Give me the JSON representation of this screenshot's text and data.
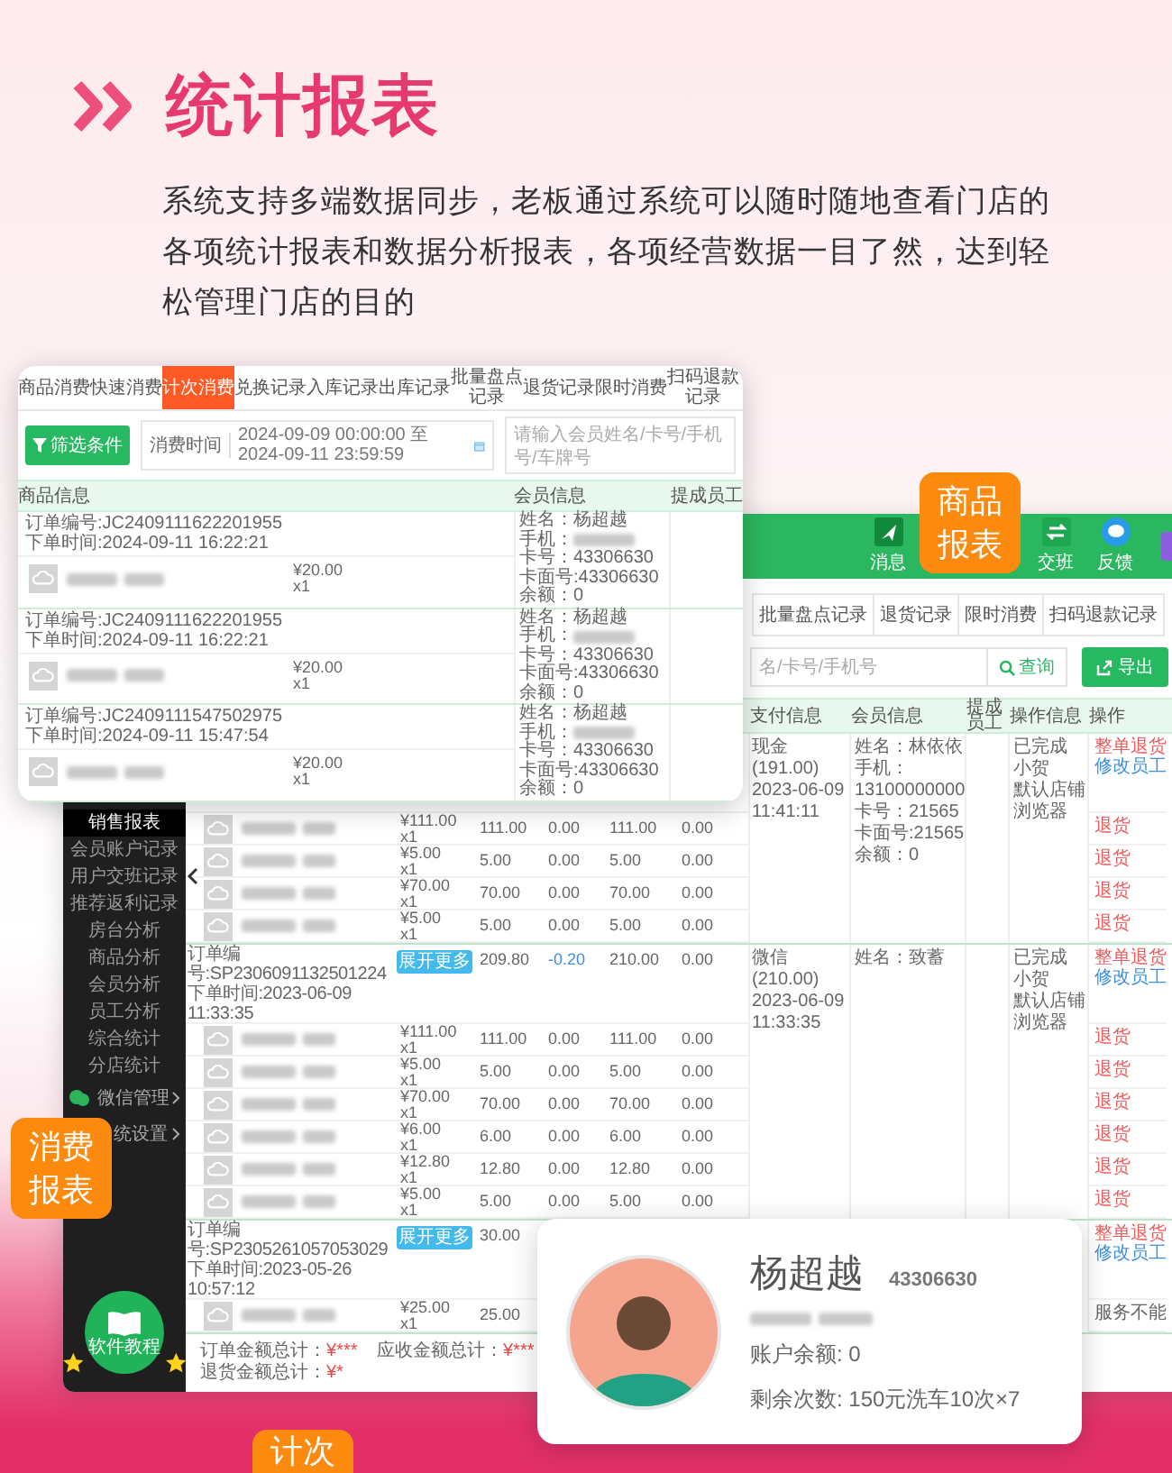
{
  "header": {
    "title": "统计报表",
    "description": "系统支持多端数据同步，老板通过系统可以随时随地查看门店的各项统计报表和数据分析报表，各项经营数据一目了然，达到轻松管理门店的目的"
  },
  "badges": [
    {
      "text": "商品报表",
      "kind": "product"
    },
    {
      "text": "消费报表",
      "kind": "consume"
    },
    {
      "text": "计次",
      "kind": "count"
    }
  ],
  "back_window": {
    "toolbar": [
      {
        "label": "消息",
        "kind": "send"
      },
      {
        "label": "交班",
        "kind": "swap"
      },
      {
        "label": "反馈",
        "kind": "chat"
      },
      {
        "kind": "download"
      }
    ],
    "tabs": [
      "批量盘点记录",
      "退货记录",
      "限时消费",
      "扫码退款记录"
    ],
    "search": {
      "placeholder": "名/卡号/手机号"
    },
    "query_button": "查询",
    "export_button": "导出",
    "columns": [
      "支付信息",
      "会员信息",
      "提成员工",
      "操作信息",
      "操作"
    ],
    "sidebar": {
      "items": [
        {
          "label": "销售报表",
          "selected": true
        },
        {
          "label": "会员账户记录",
          "selected": false
        },
        {
          "label": "用户交班记录",
          "selected": false
        },
        {
          "label": "推荐返利记录",
          "selected": false
        },
        {
          "label": "房台分析",
          "selected": false
        },
        {
          "label": "商品分析",
          "selected": false
        },
        {
          "label": "会员分析",
          "selected": false
        },
        {
          "label": "员工分析",
          "selected": false
        },
        {
          "label": "综合统计",
          "selected": false
        },
        {
          "label": "分店统计",
          "selected": false
        }
      ],
      "groups": [
        {
          "label": "微信管理",
          "kind": "wechat"
        },
        {
          "label": "统设置",
          "kind": "plain"
        }
      ],
      "tutorial": "软件教程"
    },
    "groups": [
      {
        "payment": [
          "现金(191.00)",
          "2023-06-09",
          "11:41:11"
        ],
        "member": [
          "姓名：林依依",
          "手机：13100000000",
          "卡号：21565",
          "卡面号:21565",
          "余额：0"
        ],
        "op_info": [
          "已完成",
          "小贺",
          "默认店铺",
          "浏览器"
        ],
        "actions": [
          "整单退货",
          "修改员工"
        ],
        "items": [
          {
            "price": "¥111.00",
            "qty": "x1",
            "values": [
              "111.00",
              "0.00",
              "111.00",
              "0.00"
            ],
            "action": {
              "text": "退货",
              "kind": "return"
            }
          },
          {
            "price": "¥5.00",
            "qty": "x1",
            "values": [
              "5.00",
              "0.00",
              "5.00",
              "0.00"
            ],
            "action": {
              "text": "退货",
              "kind": "return"
            }
          },
          {
            "price": "¥70.00",
            "qty": "x1",
            "values": [
              "70.00",
              "0.00",
              "70.00",
              "0.00"
            ],
            "action": {
              "text": "退货",
              "kind": "return"
            }
          },
          {
            "price": "¥5.00",
            "qty": "x1",
            "values": [
              "5.00",
              "0.00",
              "5.00",
              "0.00"
            ],
            "action": {
              "text": "退货",
              "kind": "return"
            }
          }
        ]
      },
      {
        "order": {
          "number": "订单编号:SP2306091132501224",
          "time": "下单时间:2023-06-09 11:33:35",
          "badge": "展开更多",
          "values": [
            "209.80",
            "-0.20",
            "210.00",
            "0.00"
          ]
        },
        "payment": [
          "微信(210.00)",
          "2023-06-09",
          "11:33:35"
        ],
        "member": [
          "姓名：致蓄"
        ],
        "op_info": [
          "已完成",
          "小贺",
          "默认店铺",
          "浏览器"
        ],
        "actions": [
          "整单退货",
          "修改员工"
        ],
        "items": [
          {
            "price": "¥111.00",
            "qty": "x1",
            "values": [
              "111.00",
              "0.00",
              "111.00",
              "0.00"
            ],
            "action": {
              "text": "退货",
              "kind": "return"
            }
          },
          {
            "price": "¥5.00",
            "qty": "x1",
            "values": [
              "5.00",
              "0.00",
              "5.00",
              "0.00"
            ],
            "action": {
              "text": "退货",
              "kind": "return"
            }
          },
          {
            "price": "¥70.00",
            "qty": "x1",
            "values": [
              "70.00",
              "0.00",
              "70.00",
              "0.00"
            ],
            "action": {
              "text": "退货",
              "kind": "return"
            }
          },
          {
            "price": "¥6.00",
            "qty": "x1",
            "values": [
              "6.00",
              "0.00",
              "6.00",
              "0.00"
            ],
            "action": {
              "text": "退货",
              "kind": "return"
            }
          },
          {
            "price": "¥12.80",
            "qty": "x1",
            "values": [
              "12.80",
              "0.00",
              "12.80",
              "0.00"
            ],
            "action": {
              "text": "退货",
              "kind": "return"
            }
          },
          {
            "price": "¥5.00",
            "qty": "x1",
            "values": [
              "5.00",
              "0.00",
              "5.00",
              "0.00"
            ],
            "action": {
              "text": "退货",
              "kind": "return"
            }
          }
        ]
      },
      {
        "order": {
          "number": "订单编号:SP2305261057053029",
          "time": "下单时间:2023-05-26 10:57:12",
          "badge": "展开更多",
          "values": [
            "30.00"
          ]
        },
        "actions": [
          "整单退货",
          "修改员工"
        ],
        "items": [
          {
            "price": "¥25.00",
            "qty": "x1",
            "values": [
              "25.00"
            ],
            "action": {
              "text": "服务不能",
              "kind": "note"
            }
          }
        ]
      }
    ],
    "totals": [
      {
        "label": "订单金额总计：",
        "value": "¥***"
      },
      {
        "label": "应收金额总计：",
        "value": "¥***"
      },
      {
        "label": "退货金额总计：",
        "value": "¥*"
      }
    ]
  },
  "front_window": {
    "tabs": [
      {
        "label": "商品消费",
        "selected": false
      },
      {
        "label": "快速消费",
        "selected": false
      },
      {
        "label": "计次消费",
        "selected": true
      },
      {
        "label": "兑换记录",
        "selected": false
      },
      {
        "label": "入库记录",
        "selected": false
      },
      {
        "label": "出库记录",
        "selected": false
      },
      {
        "label": "批量盘点记录",
        "selected": false
      },
      {
        "label": "退货记录",
        "selected": false
      },
      {
        "label": "限时消费",
        "selected": false
      },
      {
        "label": "扫码退款记录",
        "selected": false
      }
    ],
    "filter_button": "筛选条件",
    "date_label": "消费时间",
    "date_range": "2024-09-09 00:00:00 至 2024-09-11 23:59:59",
    "search": {
      "placeholder": "请输入会员姓名/卡号/手机号/车牌号"
    },
    "columns": [
      "商品信息",
      "会员信息",
      "提成员工"
    ],
    "orders": [
      {
        "number": "订单编号:JC2409111622201955",
        "time": "下单时间:2024-09-11 16:22:21",
        "price": "¥20.00",
        "qty": "x1",
        "member": {
          "name": "姓名：杨超越",
          "phone": "手机：",
          "card": "卡号：43306630",
          "card_face": "卡面号:43306630",
          "balance": "余额：0"
        }
      },
      {
        "number": "订单编号:JC2409111622201955",
        "time": "下单时间:2024-09-11 16:22:21",
        "price": "¥20.00",
        "qty": "x1",
        "member": {
          "name": "姓名：杨超越",
          "phone": "手机：",
          "card": "卡号：43306630",
          "card_face": "卡面号:43306630",
          "balance": "余额：0"
        }
      },
      {
        "number": "订单编号:JC2409111547502975",
        "time": "下单时间:2024-09-11 15:47:54",
        "price": "¥20.00",
        "qty": "x1",
        "member": {
          "name": "姓名：杨超越",
          "phone": "手机：",
          "card": "卡号：43306630",
          "card_face": "卡面号:43306630",
          "balance": "余额：0"
        }
      }
    ]
  },
  "member_card": {
    "name": "杨超越",
    "card_no": "43306630",
    "balance": "账户余额:  0",
    "remaining": "剩余次数:  150元洗车10次×7"
  }
}
